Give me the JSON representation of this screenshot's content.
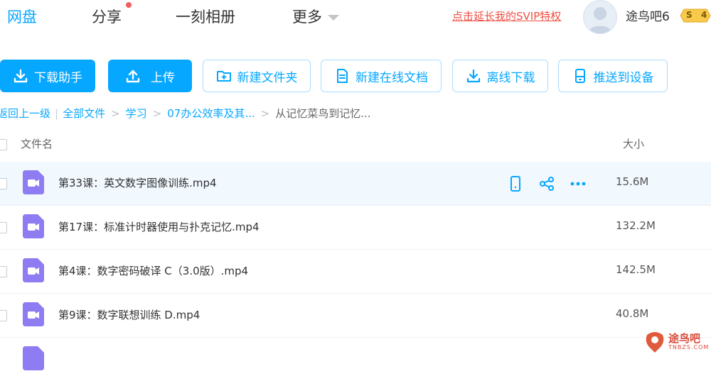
{
  "nav": {
    "tabs": [
      {
        "label": "网盘",
        "active": true
      },
      {
        "label": "分享",
        "badge": true
      },
      {
        "label": "一刻相册"
      },
      {
        "label": "更多"
      }
    ],
    "promo": "点击延长我的SVIP特权",
    "user": {
      "name": "途鸟吧6",
      "vip_letter": "S",
      "vip_level": "4"
    }
  },
  "toolbar": {
    "buttons": [
      {
        "label": "下载助手",
        "icon": "download-icon",
        "style": "primary"
      },
      {
        "label": "上传",
        "icon": "upload-icon",
        "style": "primary"
      },
      {
        "label": "新建文件夹",
        "icon": "new-folder-icon",
        "style": "outline"
      },
      {
        "label": "新建在线文档",
        "icon": "document-icon",
        "style": "outline"
      },
      {
        "label": "离线下载",
        "icon": "offline-download-icon",
        "style": "outline"
      },
      {
        "label": "推送到设备",
        "icon": "device-icon",
        "style": "outline"
      }
    ]
  },
  "breadcrumb": {
    "back": "返回上一级",
    "items": [
      "全部文件",
      "学习",
      "07办公效率及其...",
      "从记忆菜鸟到记忆..."
    ]
  },
  "table": {
    "col_name": "文件名",
    "col_size": "大小",
    "rows": [
      {
        "name": "第33课：英文数字图像训练.mp4",
        "size": "15.6M"
      },
      {
        "name": "第17课：标准计时器使用与扑克记忆.mp4",
        "size": "132.2M"
      },
      {
        "name": "第4课：数字密码破译 C（3.0版）.mp4",
        "size": "142.5M"
      },
      {
        "name": "第9课：数字联想训练 D.mp4",
        "size": "40.8M"
      }
    ]
  },
  "watermark": {
    "title": "途鸟吧",
    "domain": "TNBZS.COM"
  },
  "colors": {
    "accent": "#06a7ff",
    "video_icon": "#8d7cf2",
    "promo": "#f04e42"
  }
}
